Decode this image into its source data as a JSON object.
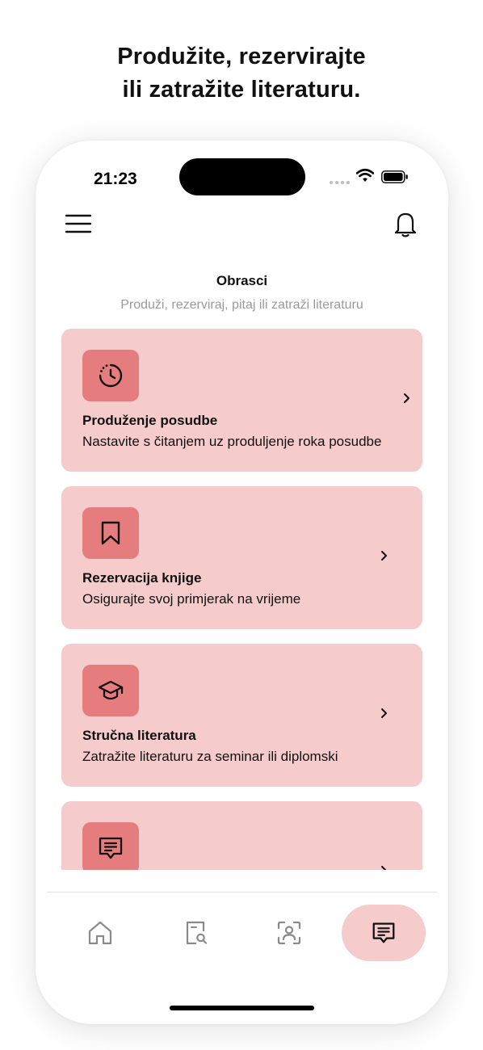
{
  "headline": {
    "line1": "Produžite, rezervirajte",
    "line2": "ili zatražite literaturu."
  },
  "status_bar": {
    "time": "21:23",
    "icons": [
      "signal-dots-icon",
      "wifi-icon",
      "battery-icon"
    ]
  },
  "header": {
    "menu_icon": "hamburger-menu-icon",
    "notification_icon": "bell-icon"
  },
  "page": {
    "title": "Obrasci",
    "subtitle": "Produži, rezerviraj, pitaj ili zatraži literaturu"
  },
  "cards": [
    {
      "icon": "timer-icon",
      "title": "Produženje posudbe",
      "description": "Nastavite s čitanjem uz produljenje roka posudbe"
    },
    {
      "icon": "bookmark-icon",
      "title": "Rezervacija knjige",
      "description": "Osigurajte svoj primjerak na vrijeme"
    },
    {
      "icon": "graduation-cap-icon",
      "title": "Stručna literatura",
      "description": "Zatražite literaturu za seminar ili diplomski"
    },
    {
      "icon": "message-icon",
      "title": "",
      "description": ""
    }
  ],
  "tabs": [
    {
      "name": "home",
      "icon": "home-icon",
      "active": false
    },
    {
      "name": "catalog-search",
      "icon": "document-search-icon",
      "active": false
    },
    {
      "name": "scan",
      "icon": "scan-user-icon",
      "active": false
    },
    {
      "name": "forms",
      "icon": "message-icon",
      "active": true
    }
  ],
  "colors": {
    "card_bg": "#f5cbcb",
    "icon_tile": "#e57d7e",
    "active_tab": "#f5cbcb",
    "subtitle_gray": "#9a9a9a"
  }
}
